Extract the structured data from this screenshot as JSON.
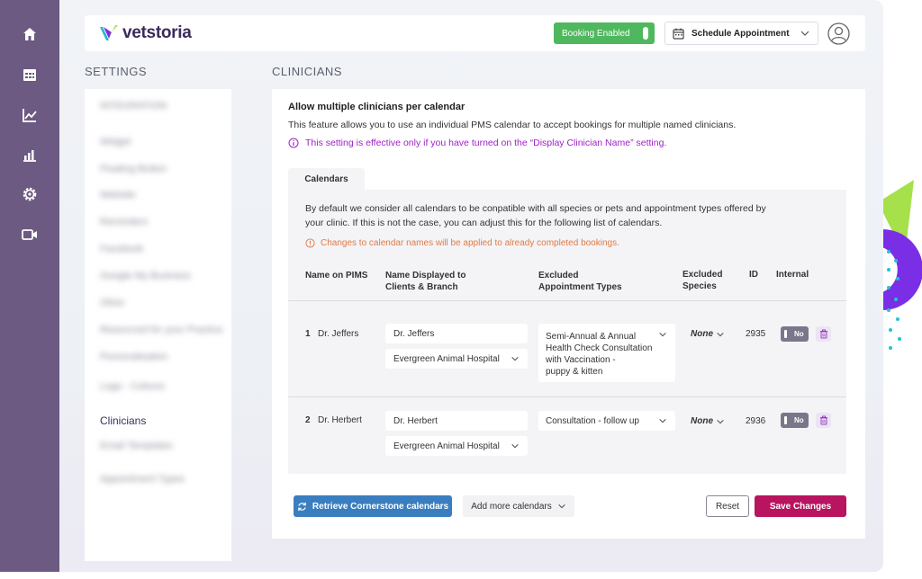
{
  "app": {
    "logo_text": "vetstoria",
    "booking_toggle_label": "Booking Enabled",
    "schedule_label": "Schedule Appointment"
  },
  "nav": {
    "icons": [
      "home-icon",
      "calendar-grid-icon",
      "line-chart-icon",
      "bar-chart-icon",
      "gear-icon",
      "video-icon"
    ]
  },
  "settings": {
    "title": "SETTINGS",
    "items": [
      {
        "label": "INTEGRATION",
        "blurred": true
      },
      {
        "label": "Widget",
        "blurred": true
      },
      {
        "label": "Floating Button",
        "blurred": true
      },
      {
        "label": "Website",
        "blurred": true
      },
      {
        "label": "Reminders",
        "blurred": true
      },
      {
        "label": "Facebook",
        "blurred": true
      },
      {
        "label": "Google My Business",
        "blurred": true
      },
      {
        "label": "Other",
        "blurred": true
      },
      {
        "label": "Resourced for your Practice",
        "blurred": true
      },
      {
        "label": "Personalisation",
        "blurred": true
      },
      {
        "label": "Logo - Colours",
        "blurred": true
      },
      {
        "label": "Clinicians",
        "blurred": false
      },
      {
        "label": "Email Templates",
        "blurred": true
      },
      {
        "label": "Appointment Types",
        "blurred": true
      }
    ]
  },
  "clinicians": {
    "title": "CLINICIANS",
    "heading": "Allow multiple clinicians per calendar",
    "description": "This feature allows you to use an individual PMS calendar to accept bookings for multiple named clinicians.",
    "info_note": "This setting is effective only if you have turned on the “Display Clinician Name” setting.",
    "tab_label": "Calendars",
    "calendars_desc_line1": "By default we consider all calendars to be conpatible with all species or pets and appointment types offered by",
    "calendars_desc_line2": "your clinic. If this is not the case, you can adjust this for the following list of calendars.",
    "warning": "Changes to calendar names will be applied to already completed bookings.",
    "columns": {
      "name_on_pims": "Name on PIMS",
      "name_displayed_1": "Name Displayed to",
      "name_displayed_2": "Clients & Branch",
      "excluded_appt_1": "Excluded",
      "excluded_appt_2": "Appointment Types",
      "excluded_species_1": "Excluded",
      "excluded_species_2": "Species",
      "id": "ID",
      "internal": "Internal"
    },
    "rows": [
      {
        "index": "1",
        "pims_name": "Dr. Jeffers",
        "display_name": "Dr. Jeffers",
        "branch": "Evergreen Animal Hospital",
        "excluded_types_lines": [
          "Semi-Annual & Annual",
          "Health Check Consultation",
          "with Vaccination -",
          "puppy & kitten"
        ],
        "excluded_species": "None",
        "id": "2935",
        "internal": "No"
      },
      {
        "index": "2",
        "pims_name": "Dr. Herbert",
        "display_name": "Dr. Herbert",
        "branch": "Evergreen Animal Hospital",
        "excluded_types_lines": [
          "Consultation - follow up"
        ],
        "excluded_species": "None",
        "id": "2936",
        "internal": "No"
      }
    ],
    "buttons": {
      "retrieve": "Retrieve Cornerstone calendars",
      "add_more": "Add more calendars",
      "reset": "Reset",
      "save": "Save Changes"
    }
  },
  "colors": {
    "sidebar": "#6c5a82",
    "booking_green": "#4fb85e",
    "info_purple": "#a020c8",
    "warning_orange": "#e07a45",
    "primary_blue": "#3a7ebf",
    "save_magenta": "#b8145f"
  }
}
